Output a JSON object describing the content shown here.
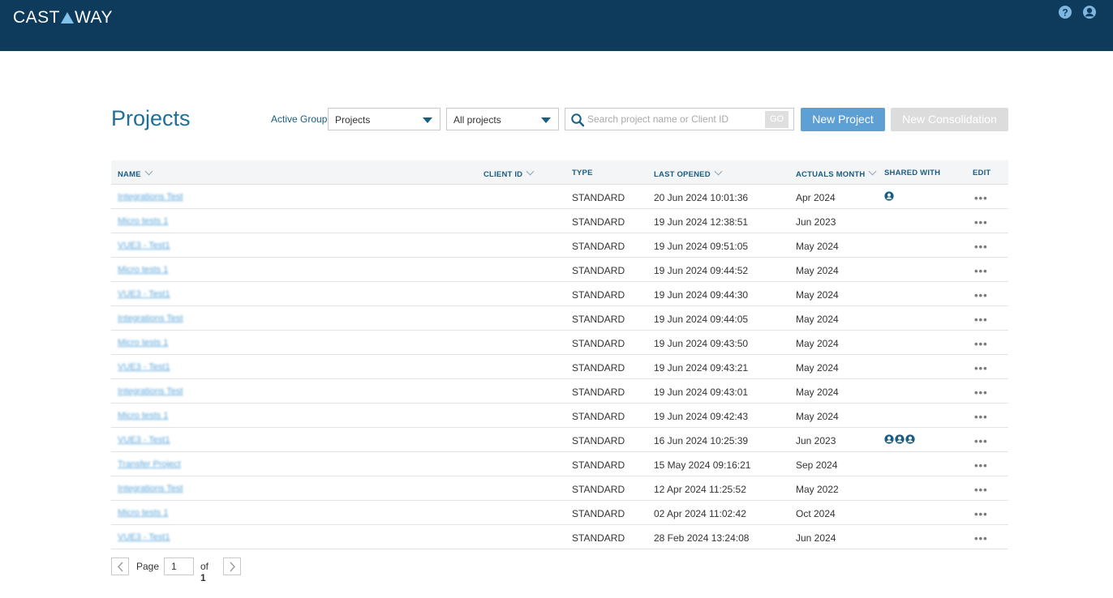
{
  "header": {
    "logo": "CASTAWAY"
  },
  "page": {
    "title": "Projects"
  },
  "filters": {
    "group_label": "Active Group",
    "group_value": "Projects",
    "scope_value": "All projects",
    "search_placeholder": "Search project name or Client ID",
    "go_label": "GO"
  },
  "actions": {
    "new_project": "New Project",
    "new_consolidation": "New Consolidation"
  },
  "table": {
    "columns": {
      "name": "NAME",
      "client_id": "CLIENT ID",
      "type": "TYPE",
      "last_opened": "LAST OPENED",
      "actuals_month": "ACTUALS MONTH",
      "shared_with": "SHARED WITH",
      "edit": "EDIT"
    },
    "rows": [
      {
        "name": "Integrations Test",
        "type": "STANDARD",
        "last_opened": "20 Jun 2024 10:01:36",
        "actuals_month": "Apr 2024",
        "shared": 1,
        "edit": "•••"
      },
      {
        "name": "Micro tests 1",
        "type": "STANDARD",
        "last_opened": "19 Jun 2024 12:38:51",
        "actuals_month": "Jun 2023",
        "shared": 0,
        "edit": "•••"
      },
      {
        "name": "VUE3 - Test1",
        "type": "STANDARD",
        "last_opened": "19 Jun 2024 09:51:05",
        "actuals_month": "May 2024",
        "shared": 0,
        "edit": "•••"
      },
      {
        "name": "Micro tests 1",
        "type": "STANDARD",
        "last_opened": "19 Jun 2024 09:44:52",
        "actuals_month": "May 2024",
        "shared": 0,
        "edit": "•••"
      },
      {
        "name": "VUE3 - Test1",
        "type": "STANDARD",
        "last_opened": "19 Jun 2024 09:44:30",
        "actuals_month": "May 2024",
        "shared": 0,
        "edit": "•••"
      },
      {
        "name": "Integrations Test",
        "type": "STANDARD",
        "last_opened": "19 Jun 2024 09:44:05",
        "actuals_month": "May 2024",
        "shared": 0,
        "edit": "•••"
      },
      {
        "name": "Micro tests 1",
        "type": "STANDARD",
        "last_opened": "19 Jun 2024 09:43:50",
        "actuals_month": "May 2024",
        "shared": 0,
        "edit": "•••"
      },
      {
        "name": "VUE3 - Test1",
        "type": "STANDARD",
        "last_opened": "19 Jun 2024 09:43:21",
        "actuals_month": "May 2024",
        "shared": 0,
        "edit": "•••"
      },
      {
        "name": "Integrations Test",
        "type": "STANDARD",
        "last_opened": "19 Jun 2024 09:43:01",
        "actuals_month": "May 2024",
        "shared": 0,
        "edit": "•••"
      },
      {
        "name": "Micro tests 1",
        "type": "STANDARD",
        "last_opened": "19 Jun 2024 09:42:43",
        "actuals_month": "May 2024",
        "shared": 0,
        "edit": "•••"
      },
      {
        "name": "VUE3 - Test1",
        "type": "STANDARD",
        "last_opened": "16 Jun 2024 10:25:39",
        "actuals_month": "Jun 2023",
        "shared": 3,
        "edit": "•••"
      },
      {
        "name": "Transfer Project",
        "type": "STANDARD",
        "last_opened": "15 May 2024 09:16:21",
        "actuals_month": "Sep 2024",
        "shared": 0,
        "edit": "•••"
      },
      {
        "name": "Integrations Test",
        "type": "STANDARD",
        "last_opened": "12 Apr 2024 11:25:52",
        "actuals_month": "May 2022",
        "shared": 0,
        "edit": "•••"
      },
      {
        "name": "Micro tests 1",
        "type": "STANDARD",
        "last_opened": "02 Apr 2024 11:02:42",
        "actuals_month": "Oct 2024",
        "shared": 0,
        "edit": "•••"
      },
      {
        "name": "VUE3 - Test1",
        "type": "STANDARD",
        "last_opened": "28 Feb 2024 13:24:08",
        "actuals_month": "Jun 2024",
        "shared": 0,
        "edit": "•••"
      }
    ]
  },
  "pagination": {
    "page_label": "Page",
    "current": "1",
    "of_label": "of",
    "total": "1"
  },
  "colors": {
    "header_bg": "#0e3a5c",
    "accent": "#1f6f99",
    "primary_button": "#5e9fd4",
    "link": "#5ea7da"
  }
}
